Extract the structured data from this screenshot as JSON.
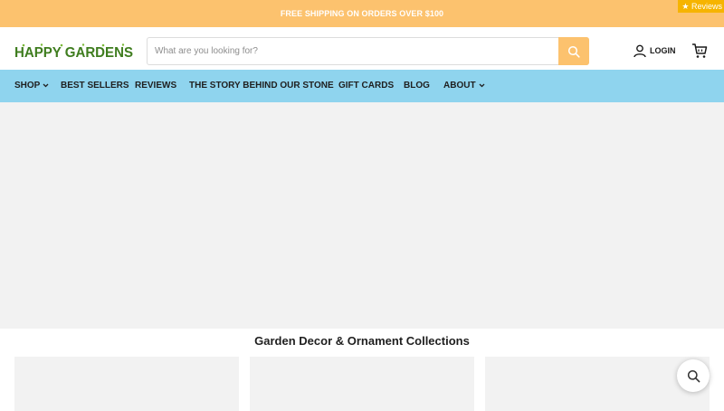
{
  "announcement": {
    "text": "FREE SHIPPING ON ORDERS OVER $100"
  },
  "reviews_tab": {
    "label": "★ Reviews"
  },
  "brand": {
    "name": "HAPPY GARDENS",
    "logo_color": "#3f7d1f"
  },
  "search": {
    "placeholder": "What are you looking for?",
    "value": "",
    "button_icon": "search-icon"
  },
  "account": {
    "login_label": "LOGIN",
    "user_icon": "user-icon",
    "cart_icon": "cart-icon"
  },
  "nav": {
    "items": [
      {
        "label": "SHOP",
        "dropdown": true
      },
      {
        "label": "BEST SELLERS",
        "dropdown": false
      },
      {
        "label": "REVIEWS",
        "dropdown": false
      },
      {
        "label": "THE STORY BEHIND OUR STONE",
        "dropdown": false
      },
      {
        "label": "GIFT CARDS",
        "dropdown": false
      },
      {
        "label": "BLOG",
        "dropdown": false
      },
      {
        "label": "ABOUT",
        "dropdown": true
      }
    ]
  },
  "collections": {
    "title": "Garden Decor & Ornament Collections",
    "card_count": 3
  },
  "floating_search": {
    "icon": "search-icon"
  },
  "colors": {
    "announcement_bg": "#fcc26e",
    "nav_bg": "#8fd4ee",
    "placeholder_bg": "#f2f2f2",
    "reviews_bg": "#f6b400"
  }
}
